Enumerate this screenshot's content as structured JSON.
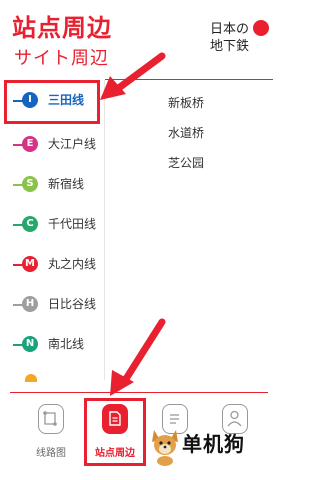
{
  "header": {
    "title": "站点周边",
    "subtitle": "サイト周辺",
    "logo_line1": "日本の",
    "logo_line2": "地下鉄"
  },
  "lines": [
    {
      "badge": "I",
      "label": "三田线",
      "color": "#1565c0",
      "active": true
    },
    {
      "badge": "E",
      "label": "大江户线",
      "color": "#d63384",
      "active": false
    },
    {
      "badge": "S",
      "label": "新宿线",
      "color": "#8bc34a",
      "active": false
    },
    {
      "badge": "C",
      "label": "千代田线",
      "color": "#26a86b",
      "active": false
    },
    {
      "badge": "M",
      "label": "丸之内线",
      "color": "#e8202f",
      "active": false
    },
    {
      "badge": "H",
      "label": "日比谷线",
      "color": "#9e9e9e",
      "active": false
    },
    {
      "badge": "N",
      "label": "南北线",
      "color": "#18a37b",
      "active": false
    }
  ],
  "stations": [
    "新板桥",
    "水道桥",
    "芝公园"
  ],
  "tabs": [
    {
      "label": "线路图",
      "icon": "map-route-icon",
      "active": false
    },
    {
      "label": "站点周边",
      "icon": "document-icon",
      "active": true
    },
    {
      "label": "",
      "icon": "document-list-icon",
      "active": false
    },
    {
      "label": "",
      "icon": "user-icon",
      "active": false
    }
  ],
  "watermark": {
    "text": "单机狗"
  },
  "colors": {
    "accent": "#e8202f",
    "active_line": "#1565c0"
  }
}
